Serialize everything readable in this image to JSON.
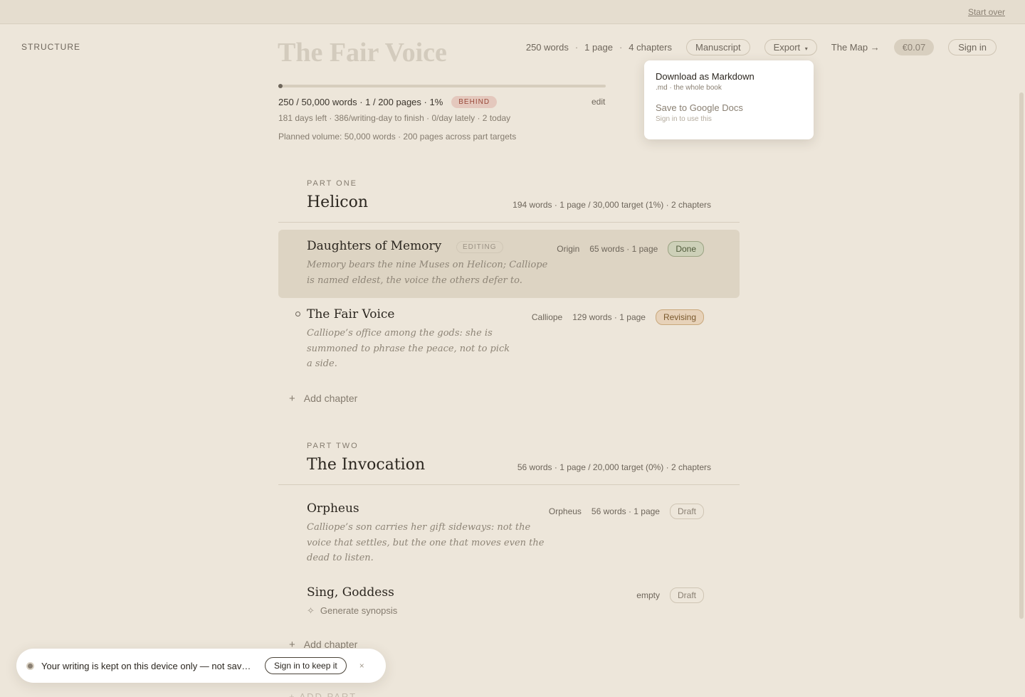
{
  "topbar": {
    "start_over": "Start over"
  },
  "sidebar": {
    "label": "STRUCTURE"
  },
  "book": {
    "title": "The Fair Voice",
    "stats": {
      "words": "250 words",
      "pages": "1 page",
      "chapters": "4 chapters",
      "sep": "·"
    },
    "manuscript_label": "Manuscript",
    "export_label": "Export",
    "export_caret": "▾",
    "map_label": "The Map →",
    "price": "€0.07",
    "signin_label": "Sign in"
  },
  "progress": {
    "fraction": 0.01,
    "line": "250 / 50,000 words · 1 / 200 pages · 1%",
    "status_badge": "BEHIND",
    "edit_label": "edit",
    "pace": "181 days left · 386/writing-day to finish · 0/day lately · 2 today",
    "planned": "Planned volume: 50,000 words · 200 pages across part targets"
  },
  "export_menu": {
    "items": [
      {
        "title": "Download as Markdown",
        "sub": ".md · the whole book"
      },
      {
        "title": "Save to Google Docs",
        "sub": "Sign in to use this"
      }
    ]
  },
  "parts": [
    {
      "label": "PART ONE",
      "title": "Helicon",
      "meta": "194 words · 1 page / 30,000 target (1%) · 2 chapters",
      "chapters": [
        {
          "title": "Daughters of Memory",
          "editing_tag": "EDITING",
          "synopsis_1": "Memory bears the nine Muses on Helicon; Calliope",
          "synopsis_2": "is named eldest, the voice the others defer to.",
          "pov": "Origin",
          "stats": "65 words · 1 page",
          "status": "Done"
        },
        {
          "title": "The Fair Voice",
          "synopsis_1": "Calliope’s office among the gods: she is",
          "synopsis_2": "summoned to phrase the peace, not to pick",
          "synopsis_3": "a side.",
          "pov": "Calliope",
          "stats": "129 words · 1 page",
          "status": "Revising"
        }
      ],
      "add_chapter": "Add chapter"
    },
    {
      "label": "PART TWO",
      "title": "The Invocation",
      "meta": "56 words · 1 page / 20,000 target (0%) · 2 chapters",
      "chapters": [
        {
          "title": "Orpheus",
          "synopsis_1": "Calliope’s son carries her gift sideways: not the",
          "synopsis_2": "voice that settles, but the one that moves even the",
          "synopsis_3": "dead to listen.",
          "pov": "Orpheus",
          "stats": "56 words · 1 page",
          "status": "Draft"
        },
        {
          "title": "Sing, Goddess",
          "generate_synopsis": "Generate synopsis",
          "stats": "empty",
          "status": "Draft"
        }
      ],
      "add_chapter": "Add chapter"
    }
  ],
  "add_part": "+ ADD PART",
  "toast": {
    "text": "Your writing is kept on this device only — not saved to an account",
    "button": "Sign in to keep it",
    "close": "×"
  },
  "colors": {
    "background": "#ede6da",
    "done": "#cdd0b8",
    "revising": "#e7d2b9",
    "behind": "#e4c8bd"
  },
  "icons": {
    "plus": "+",
    "sparkle": "✧"
  }
}
